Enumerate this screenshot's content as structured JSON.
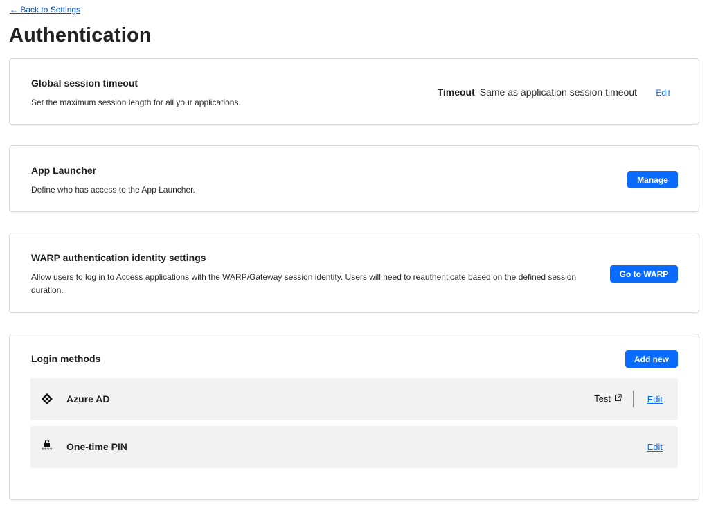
{
  "nav": {
    "back_label": "← Back to Settings"
  },
  "page": {
    "title": "Authentication"
  },
  "session_timeout": {
    "title": "Global session timeout",
    "description": "Set the maximum session length for all your applications.",
    "timeout_label": "Timeout",
    "timeout_value": "Same as application session timeout",
    "edit_label": "Edit"
  },
  "app_launcher": {
    "title": "App Launcher",
    "description": "Define who has access to the App Launcher.",
    "button_label": "Manage"
  },
  "warp": {
    "title": "WARP authentication identity settings",
    "description": "Allow users to log in to Access applications with the WARP/Gateway session identity. Users will need to reauthenticate based on the defined session duration.",
    "button_label": "Go to WARP"
  },
  "login_methods": {
    "title": "Login methods",
    "add_label": "Add new",
    "items": [
      {
        "name": "Azure AD",
        "icon": "azure-ad-icon",
        "test_label": "Test",
        "edit_label": "Edit"
      },
      {
        "name": "One-time PIN",
        "icon": "otp-lock-icon",
        "pin_mask": "****",
        "edit_label": "Edit"
      }
    ]
  },
  "colors": {
    "accent": "#0a6cff",
    "link": "#0051c3",
    "row_bg": "#f2f2f2",
    "border": "#d9d9d9"
  }
}
